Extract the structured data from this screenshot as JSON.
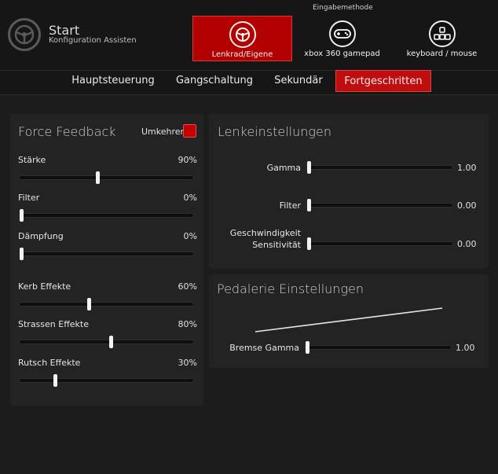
{
  "header": {
    "title": "Start",
    "subtitle": "Konfiguration Assistent",
    "input_method_label": "Eingabemethode",
    "inputs": [
      {
        "label": "Lenkrad/Eigene",
        "icon": "steering-wheel-icon",
        "active": true
      },
      {
        "label": "xbox 360 gamepad",
        "icon": "gamepad-icon",
        "active": false
      },
      {
        "label": "keyboard / mouse",
        "icon": "keyboard-icon",
        "active": false
      }
    ],
    "accent": "#c00d0d"
  },
  "tabs": [
    {
      "label": "Hauptsteuerung",
      "active": false
    },
    {
      "label": "Gangschaltung",
      "active": false
    },
    {
      "label": "Sekundär",
      "active": false
    },
    {
      "label": "Fortgeschritten",
      "active": true
    }
  ],
  "force_feedback": {
    "title": "Force Feedback",
    "invert_label": "Umkehren",
    "invert_checked": true,
    "sliders": [
      {
        "label": "Stärke",
        "value_text": "90%",
        "value": 0.45
      },
      {
        "label": "Filter",
        "value_text": "0%",
        "value": 0.0
      },
      {
        "label": "Dämpfung",
        "value_text": "0%",
        "value": 0.0
      },
      {
        "label": "Kerb Effekte",
        "value_text": "60%",
        "value": 0.4
      },
      {
        "label": "Strassen Effekte",
        "value_text": "80%",
        "value": 0.53
      },
      {
        "label": "Rutsch Effekte",
        "value_text": "30%",
        "value": 0.2
      }
    ]
  },
  "steering": {
    "title": "Lenkeinstellungen",
    "sliders": [
      {
        "label": "Gamma",
        "value_text": "1.00",
        "value": 0.0
      },
      {
        "label": "Filter",
        "value_text": "0.00",
        "value": 0.0
      },
      {
        "label": "Geschwindigkeit Sensitivität",
        "value_text": "0.00",
        "value": 0.0
      }
    ]
  },
  "pedals": {
    "title": "Pedalerie Einstellungen",
    "sliders": [
      {
        "label": "Bremse Gamma",
        "value_text": "1.00",
        "value": 0.0
      }
    ]
  }
}
